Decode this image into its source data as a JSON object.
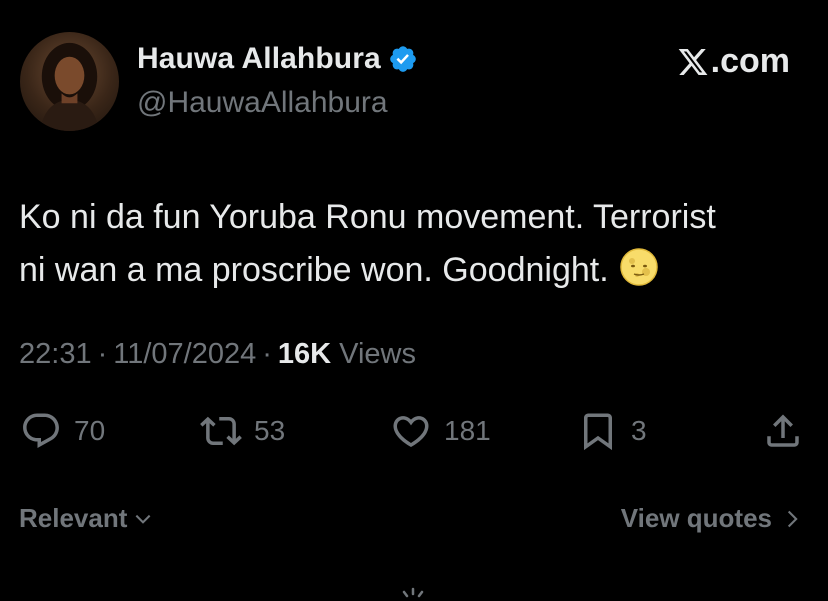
{
  "author": {
    "name": "Hauwa Allahbura",
    "handle": "@HauwaAllahbura",
    "verified": true,
    "avatar_icon": "profile-photo"
  },
  "site": {
    "label": ".com",
    "logo_icon": "x-logo-icon"
  },
  "tweet": {
    "text": "Ko ni da fun Yoruba Ronu movement. Terrorist\nni wan a ma proscribe won. Goodnight.",
    "emoji_icon": "moon-face-icon"
  },
  "meta": {
    "time": "22:31",
    "date": "11/07/2024",
    "separator": "·",
    "views_count": "16K",
    "views_label": "Views"
  },
  "actions": {
    "replies": "70",
    "reposts": "53",
    "likes": "181",
    "bookmarks": "3"
  },
  "footer": {
    "sort_label": "Relevant",
    "quotes_label": "View quotes"
  },
  "colors": {
    "background": "#000000",
    "text_primary": "#e7e9ea",
    "text_secondary": "#71767b",
    "verified_blue": "#1d9bf0"
  }
}
